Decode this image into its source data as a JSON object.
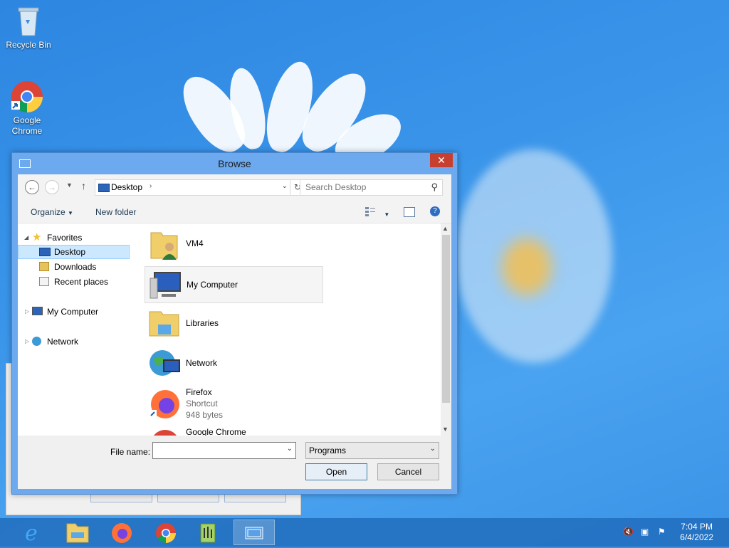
{
  "desktop": {
    "icons": [
      {
        "label": "Recycle Bin",
        "icon": "recycle-bin-icon"
      },
      {
        "label": "Google Chrome",
        "icon": "chrome-icon"
      }
    ]
  },
  "dialog": {
    "title": "Browse",
    "close_glyph": "✕",
    "address": {
      "location": "Desktop"
    },
    "search": {
      "placeholder": "Search Desktop"
    },
    "toolbar": {
      "organize": "Organize",
      "new_folder": "New folder"
    },
    "nav": {
      "favorites": "Favorites",
      "desktop": "Desktop",
      "downloads": "Downloads",
      "recent": "Recent places",
      "my_computer": "My Computer",
      "network": "Network"
    },
    "files": [
      {
        "name": "VM4",
        "icon": "user-folder-icon"
      },
      {
        "name": "My Computer",
        "icon": "computer-icon"
      },
      {
        "name": "Libraries",
        "icon": "libraries-icon"
      },
      {
        "name": "Network",
        "icon": "network-icon"
      },
      {
        "name": "Firefox",
        "sub1": "Shortcut",
        "sub2": "948 bytes",
        "icon": "firefox-icon"
      },
      {
        "name": "Google Chrome",
        "icon": "chrome-icon"
      }
    ],
    "filename_label": "File name:",
    "filename_value": "",
    "filetype_selected": "Programs",
    "open_label": "Open",
    "cancel_label": "Cancel"
  },
  "taskbar": {
    "items": [
      "internet-explorer-icon",
      "file-explorer-icon",
      "firefox-icon",
      "chrome-icon",
      "notepad-plus-plus-icon",
      "browse-dialog-icon"
    ],
    "tray": [
      "speaker-muted-icon",
      "network-icon",
      "action-center-icon"
    ],
    "time": "7:04 PM",
    "date": "6/4/2022"
  },
  "colors": {
    "accent": "#6ca9ee",
    "close": "#c7402f",
    "selection": "#cce8ff"
  }
}
